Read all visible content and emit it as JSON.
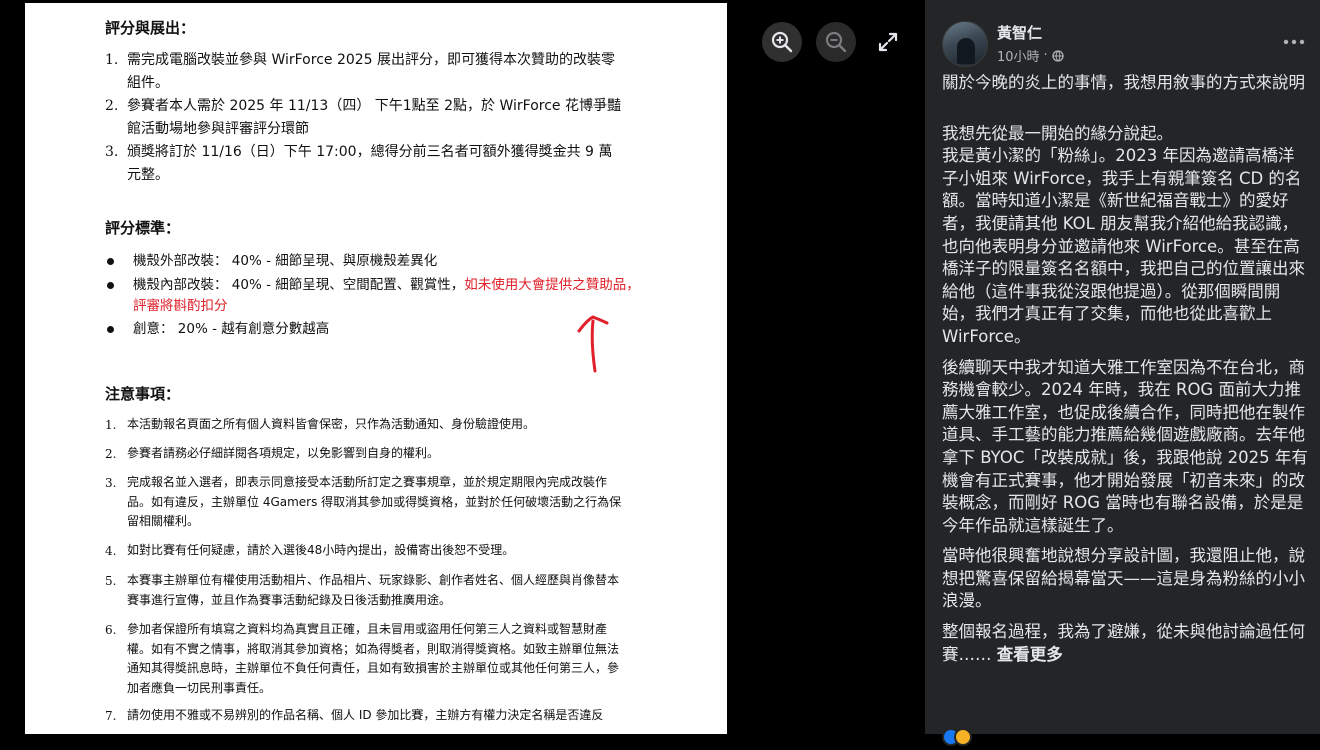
{
  "document": {
    "section1_title": "評分與展出：",
    "section1_items": [
      {
        "num": "1.",
        "text": "需完成電腦改裝並參與 WirForce 2025 展出評分，即可獲得本次贊助的改裝零組件。"
      },
      {
        "num": "2.",
        "text": "參賽者本人需於 2025 年 11/13（四） 下午1點至 2點，於 WirForce 花博爭豔館活動場地參與評審評分環節"
      },
      {
        "num": "3.",
        "text": "頒獎將訂於 11/16（日）下午 17:00，總得分前三名者可額外獲得獎金共 9 萬元整。"
      }
    ],
    "section2_title": "評分標準：",
    "criteria": [
      {
        "text": "機殼外部改裝： 40%  - 細節呈現、與原機殼差異化",
        "highlight": ""
      },
      {
        "text": "機殼內部改裝： 40% - 細節呈現、空間配置、觀賞性，",
        "highlight": "如未使用大會提供之贊助品，評審將斟酌扣分"
      },
      {
        "text": "創意： 20% - 越有創意分數越高",
        "highlight": ""
      }
    ],
    "section3_title": "注意事項：",
    "notes": [
      {
        "num": "1.",
        "text": "本活動報名頁面之所有個人資料皆會保密，只作為活動通知、身份驗證使用。"
      },
      {
        "num": "2.",
        "text": "參賽者請務必仔細詳閱各項規定，以免影響到自身的權利。"
      },
      {
        "num": "3.",
        "text": "完成報名並入選者，即表示同意接受本活動所訂定之賽事規章，並於規定期限內完成改裝作品。如有違反，主辦單位 4Gamers 得取消其參加或得獎資格，並對於任何破壞活動之行為保留相關權利。"
      },
      {
        "num": "4.",
        "text": "如對比賽有任何疑慮，請於入選後48小時內提出，設備寄出後恕不受理。"
      },
      {
        "num": "5.",
        "text": "本賽事主辦單位有權使用活動相片、作品相片、玩家錄影、創作者姓名、個人經歷與肖像替本賽事進行宣傳，並且作為賽事活動紀錄及日後活動推廣用途。"
      },
      {
        "num": "6.",
        "text": "參加者保證所有填寫之資料均為真實且正確，且未冒用或盜用任何第三人之資料或智慧財產權。如有不實之情事，將取消其參加資格；如為得獎者，則取消得獎資格。如致主辦單位無法通知其得獎訊息時，主辦單位不負任何責任，且如有致損害於主辦單位或其他任何第三人，參加者應負一切民刑事責任。"
      },
      {
        "num": "7.",
        "text": "請勿使用不雅或不易辨別的作品名稱、個人 ID 參加比賽，主辦方有權力決定名稱是否違反"
      }
    ]
  },
  "viewer_controls": {
    "zoom_in": "zoom-in-icon",
    "zoom_out": "zoom-out-icon",
    "fullscreen": "expand-icon"
  },
  "post": {
    "author": "黃智仁",
    "time": "10小時",
    "audience_icon": "globe-icon",
    "paragraphs": [
      "關於今晚的炎上的事情，我想用敘事的方式來說明",
      "我想先從最一開始的緣分說起。\n我是黃小潔的「粉絲」。2023 年因為邀請高橋洋子小姐來 WirForce，我手上有親筆簽名 CD 的名額。當時知道小潔是《新世紀福音戰士》的愛好者，我便請其他 KOL 朋友幫我介紹他給我認識，也向他表明身分並邀請他來 WirForce。甚至在高橋洋子的限量簽名名額中，我把自己的位置讓出來給他（這件事我從沒跟他提過）。從那個瞬間開始，我們才真正有了交集，而他也從此喜歡上 WirForce。",
      "後續聊天中我才知道大雅工作室因為不在台北，商務機會較少。2024 年時，我在 ROG 面前大力推薦大雅工作室，也促成後續合作，同時把他在製作道具、手工藝的能力推薦給幾個遊戲廠商。去年他拿下 BYOC「改裝成就」後，我跟他說 2025 年有機會有正式賽事，他才開始發展「初音未來」的改裝概念，而剛好 ROG 當時也有聯名設備，於是是今年作品就這樣誕生了。",
      "當時他很興奮地說想分享設計圖，我還阻止他，說想把驚喜保留給揭幕當天——這是身為粉絲的小小浪漫。",
      "整個報名過程，我為了避嫌，從未與他討論過任何賽……"
    ],
    "see_more": "查看更多"
  }
}
